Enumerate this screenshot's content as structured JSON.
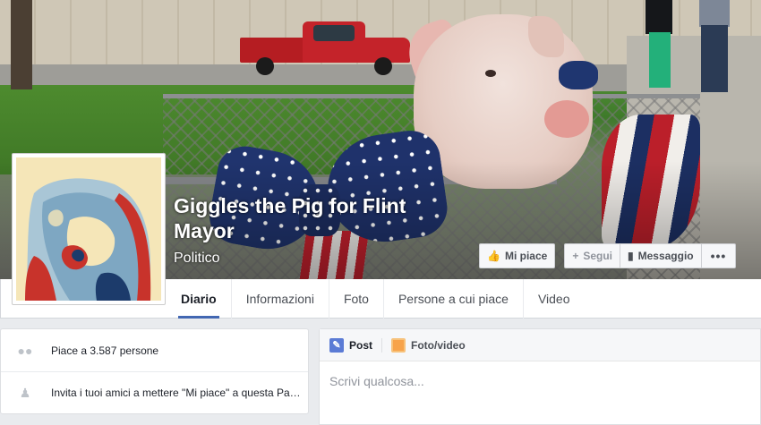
{
  "page": {
    "name": "Giggles the Pig for Flint Mayor",
    "category": "Politico"
  },
  "actions": {
    "like_label": "Mi piace",
    "follow_label": "Segui",
    "message_label": "Messaggio",
    "more_label": "•••"
  },
  "tabs": [
    {
      "label": "Diario",
      "active": true
    },
    {
      "label": "Informazioni"
    },
    {
      "label": "Foto"
    },
    {
      "label": "Persone a cui piace"
    },
    {
      "label": "Video"
    }
  ],
  "sidebar": {
    "likes_text": "Piace a 3.587 persone",
    "invite_text": "Invita i tuoi amici a mettere \"Mi piace\" a questa Pagina"
  },
  "composer": {
    "tab_post": "Post",
    "tab_photo": "Foto/video",
    "placeholder": "Scrivi qualcosa..."
  },
  "colors": {
    "accent": "#4267b2",
    "background": "#e9ebee"
  },
  "icons": {
    "like": "thumbs-up-icon",
    "follow": "plus-icon",
    "message": "message-icon",
    "more": "ellipsis-icon",
    "likes": "people-icon",
    "invite": "add-person-icon",
    "post": "pencil-icon",
    "photo": "photo-icon"
  }
}
